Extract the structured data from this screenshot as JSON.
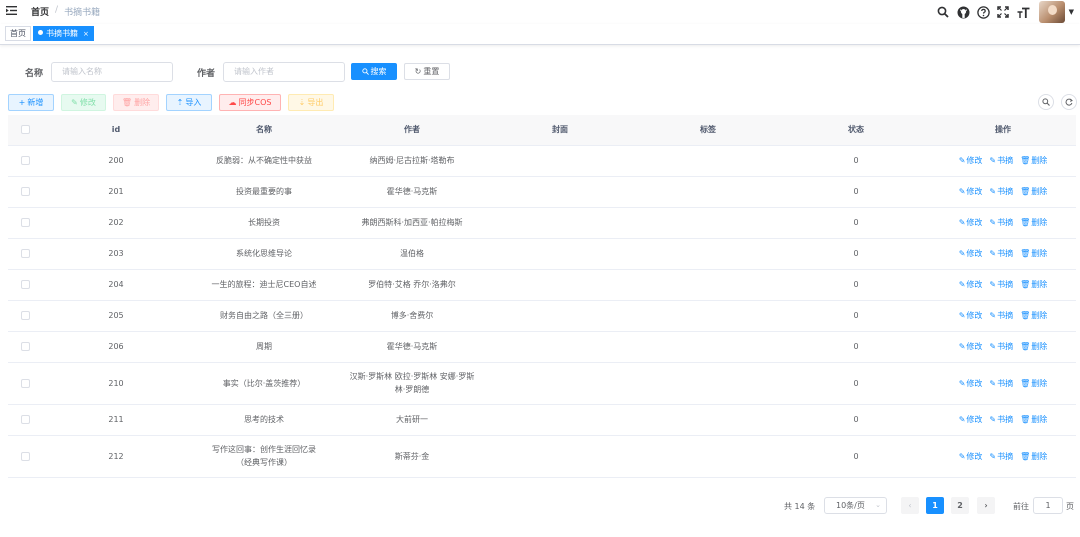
{
  "breadcrumb": {
    "home": "首页",
    "separator": "/",
    "current": "书摘书籍"
  },
  "header_icons": [
    "search-icon",
    "github-icon",
    "question-icon",
    "fullscreen-icon",
    "font-size-icon"
  ],
  "tabs": [
    {
      "label": "首页",
      "active": false
    },
    {
      "label": "书摘书籍",
      "active": true,
      "close": "×"
    }
  ],
  "search": {
    "name_label": "名称",
    "name_placeholder": "请输入名称",
    "author_label": "作者",
    "author_placeholder": "请输入作者",
    "search_button": "搜索",
    "reset_button": "重置"
  },
  "toolbar": {
    "add": "新增",
    "edit": "修改",
    "delete": "删除",
    "import": "导入",
    "sync": "同步COS",
    "export": "导出"
  },
  "table": {
    "columns": [
      "id",
      "名称",
      "作者",
      "封面",
      "标签",
      "状态",
      "操作"
    ],
    "rows": [
      {
        "id": "200",
        "name": "反脆弱：从不确定性中获益",
        "author": "纳西姆·尼古拉斯·塔勒布",
        "cover": "",
        "tags": "",
        "status": "0"
      },
      {
        "id": "201",
        "name": "投资最重要的事",
        "author": "霍华德·马克斯",
        "cover": "",
        "tags": "",
        "status": "0"
      },
      {
        "id": "202",
        "name": "长期投资",
        "author": "弗朗西斯科·加西亚·帕拉梅斯",
        "cover": "",
        "tags": "",
        "status": "0"
      },
      {
        "id": "203",
        "name": "系统化思维导论",
        "author": "温伯格",
        "cover": "",
        "tags": "",
        "status": "0"
      },
      {
        "id": "204",
        "name": "一生的旅程：迪士尼CEO自述",
        "author": "罗伯特·艾格 乔尔·洛弗尔",
        "cover": "",
        "tags": "",
        "status": "0"
      },
      {
        "id": "205",
        "name": "财务自由之路（全三册）",
        "author": "博多·舍费尔",
        "cover": "",
        "tags": "",
        "status": "0"
      },
      {
        "id": "206",
        "name": "周期",
        "author": "霍华德·马克斯",
        "cover": "",
        "tags": "",
        "status": "0"
      },
      {
        "id": "210",
        "name": "事实（比尔·盖茨推荐）",
        "author": "汉斯·罗斯林 欧拉·罗斯林 安娜·罗斯林·罗朗德",
        "cover": "",
        "tags": "",
        "status": "0"
      },
      {
        "id": "211",
        "name": "思考的技术",
        "author": "大前研一",
        "cover": "",
        "tags": "",
        "status": "0"
      },
      {
        "id": "212",
        "name": "写作这回事：创作生涯回忆录（经典写作课）",
        "author": "斯蒂芬·金",
        "cover": "",
        "tags": "",
        "status": "0"
      }
    ],
    "row_actions": {
      "edit": "修改",
      "excerpt": "书摘",
      "delete": "删除"
    }
  },
  "pagination": {
    "total": "共 14 条",
    "page_size": "10条/页",
    "pages": [
      "1",
      "2"
    ],
    "current": "1",
    "goto_label": "前往",
    "goto_value": "1",
    "page_suffix": "页"
  },
  "colors": {
    "primary": "#1890ff",
    "danger": "#ff4949",
    "success": "#13ce66",
    "warning": "#ffba00"
  }
}
